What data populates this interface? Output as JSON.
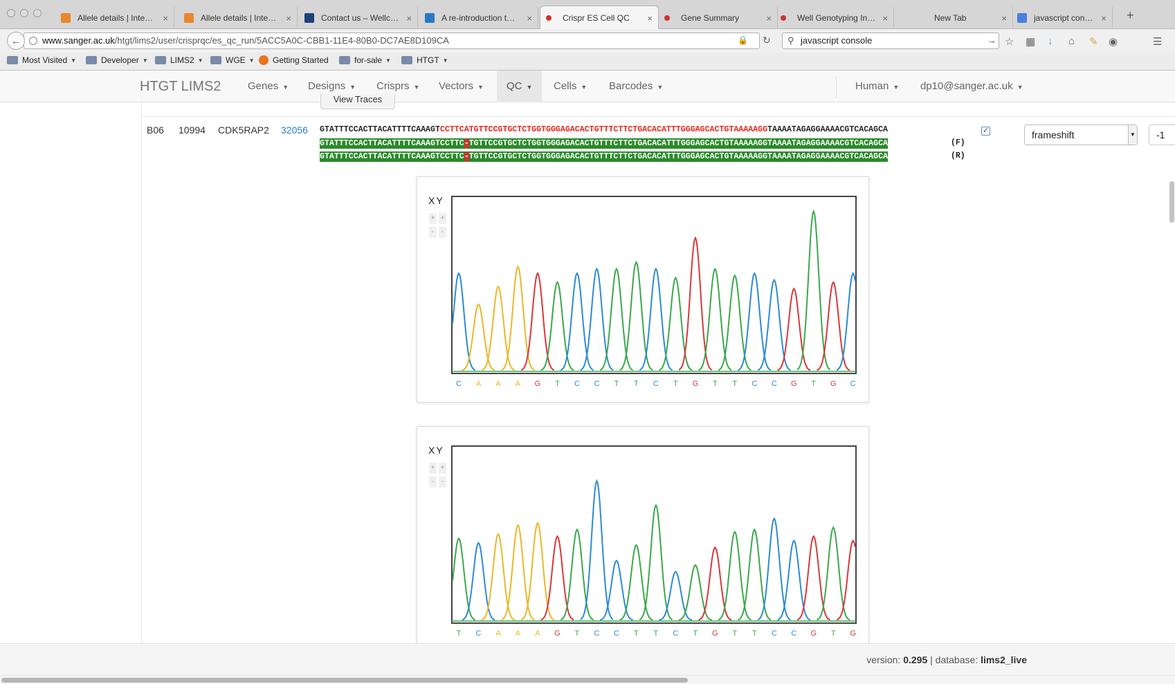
{
  "browser": {
    "tabs": [
      {
        "label": "Allele details | Inte…",
        "icon": "orange-cross-icon"
      },
      {
        "label": "Allele details | Inte…",
        "icon": "orange-cross-icon"
      },
      {
        "label": "Contact us – Wellc…",
        "icon": "wellcome-s-icon"
      },
      {
        "label": "A re-introduction t…",
        "icon": "blue-box-icon"
      },
      {
        "label": "Crispr ES Cell QC",
        "icon": "red-molecule-icon",
        "active": true
      },
      {
        "label": "Gene Summary",
        "icon": "red-molecule-icon"
      },
      {
        "label": "Well Genotyping In…",
        "icon": "red-molecule-icon"
      },
      {
        "label": "New Tab",
        "icon": ""
      },
      {
        "label": "javascript console …",
        "icon": "google-g-icon"
      }
    ],
    "url_domain": "www.sanger.ac.uk",
    "url_path": "/htgt/lims2/user/crisprqc/es_qc_run/5ACC5A0C-CBB1-11E4-80B0-DC7AE8D109CA",
    "search_value": "javascript console",
    "bookmarks": [
      "Most Visited",
      "Developer",
      "LIMS2",
      "WGE",
      "Getting Started",
      "for-sale",
      "HTGT"
    ]
  },
  "app": {
    "brand": "HTGT LIMS2",
    "nav": [
      "Genes",
      "Designs",
      "Crisprs",
      "Vectors",
      "QC",
      "Cells",
      "Barcodes"
    ],
    "active_nav": "QC",
    "species": "Human",
    "user": "dp10@sanger.ac.uk"
  },
  "row": {
    "view_traces_label": "View Traces",
    "well": "B06",
    "id": "10994",
    "gene": "CDK5RAP2",
    "gene_link": "32056",
    "ref_prefix": "GTATTTCCACTTACATTTTCAAAGT",
    "ref_crispr": "CCTTCATGTTCCGTGCTCTGGTGGGAGACACTGTTTCTTCTGACACATTTGGGAGCACTGTAAAAAGG",
    "ref_suffix": "TAAAATAGAGGAAAACGTCACAGCA",
    "read_prefix": "GTATTTCCACTTACATTTTCAAAGTCCTTC",
    "read_gap": "-",
    "read_suffix": "TGTTCCGTGCTCTGGTGGGAGACACTGTTTCTTCTGACACATTTGGGAGCACTGTAAAAAGGTAAAATAGAGGAAAACGTCACAGCA",
    "forward_label": "(F)",
    "reverse_label": "(R)",
    "accepted": true,
    "damage_type": "frameshift",
    "frame": "-1"
  },
  "traces": [
    {
      "axis_labels": "XY",
      "bases": "CAAAGTCCTTCTGTTCCGTGC",
      "peak_heights": [
        0.44,
        0.3,
        0.38,
        0.47,
        0.44,
        0.4,
        0.44,
        0.46,
        0.46,
        0.49,
        0.46,
        0.42,
        0.6,
        0.46,
        0.43,
        0.44,
        0.41,
        0.37,
        0.72,
        0.4,
        0.44
      ]
    },
    {
      "axis_labels": "XY",
      "bases": "TCAAAGTCCTTCTGTTCCGTG",
      "peak_heights": [
        0.37,
        0.35,
        0.39,
        0.43,
        0.44,
        0.38,
        0.41,
        0.63,
        0.27,
        0.34,
        0.52,
        0.22,
        0.25,
        0.33,
        0.4,
        0.41,
        0.46,
        0.36,
        0.38,
        0.42,
        0.36
      ]
    }
  ],
  "base_colors": {
    "A": "#e8b829",
    "C": "#2b8bd4",
    "G": "#d9373a",
    "T": "#3aa84a"
  },
  "footer": {
    "version_label": "version:",
    "version": "0.295",
    "sep": "|",
    "database_label": "database:",
    "database": "lims2_live"
  }
}
